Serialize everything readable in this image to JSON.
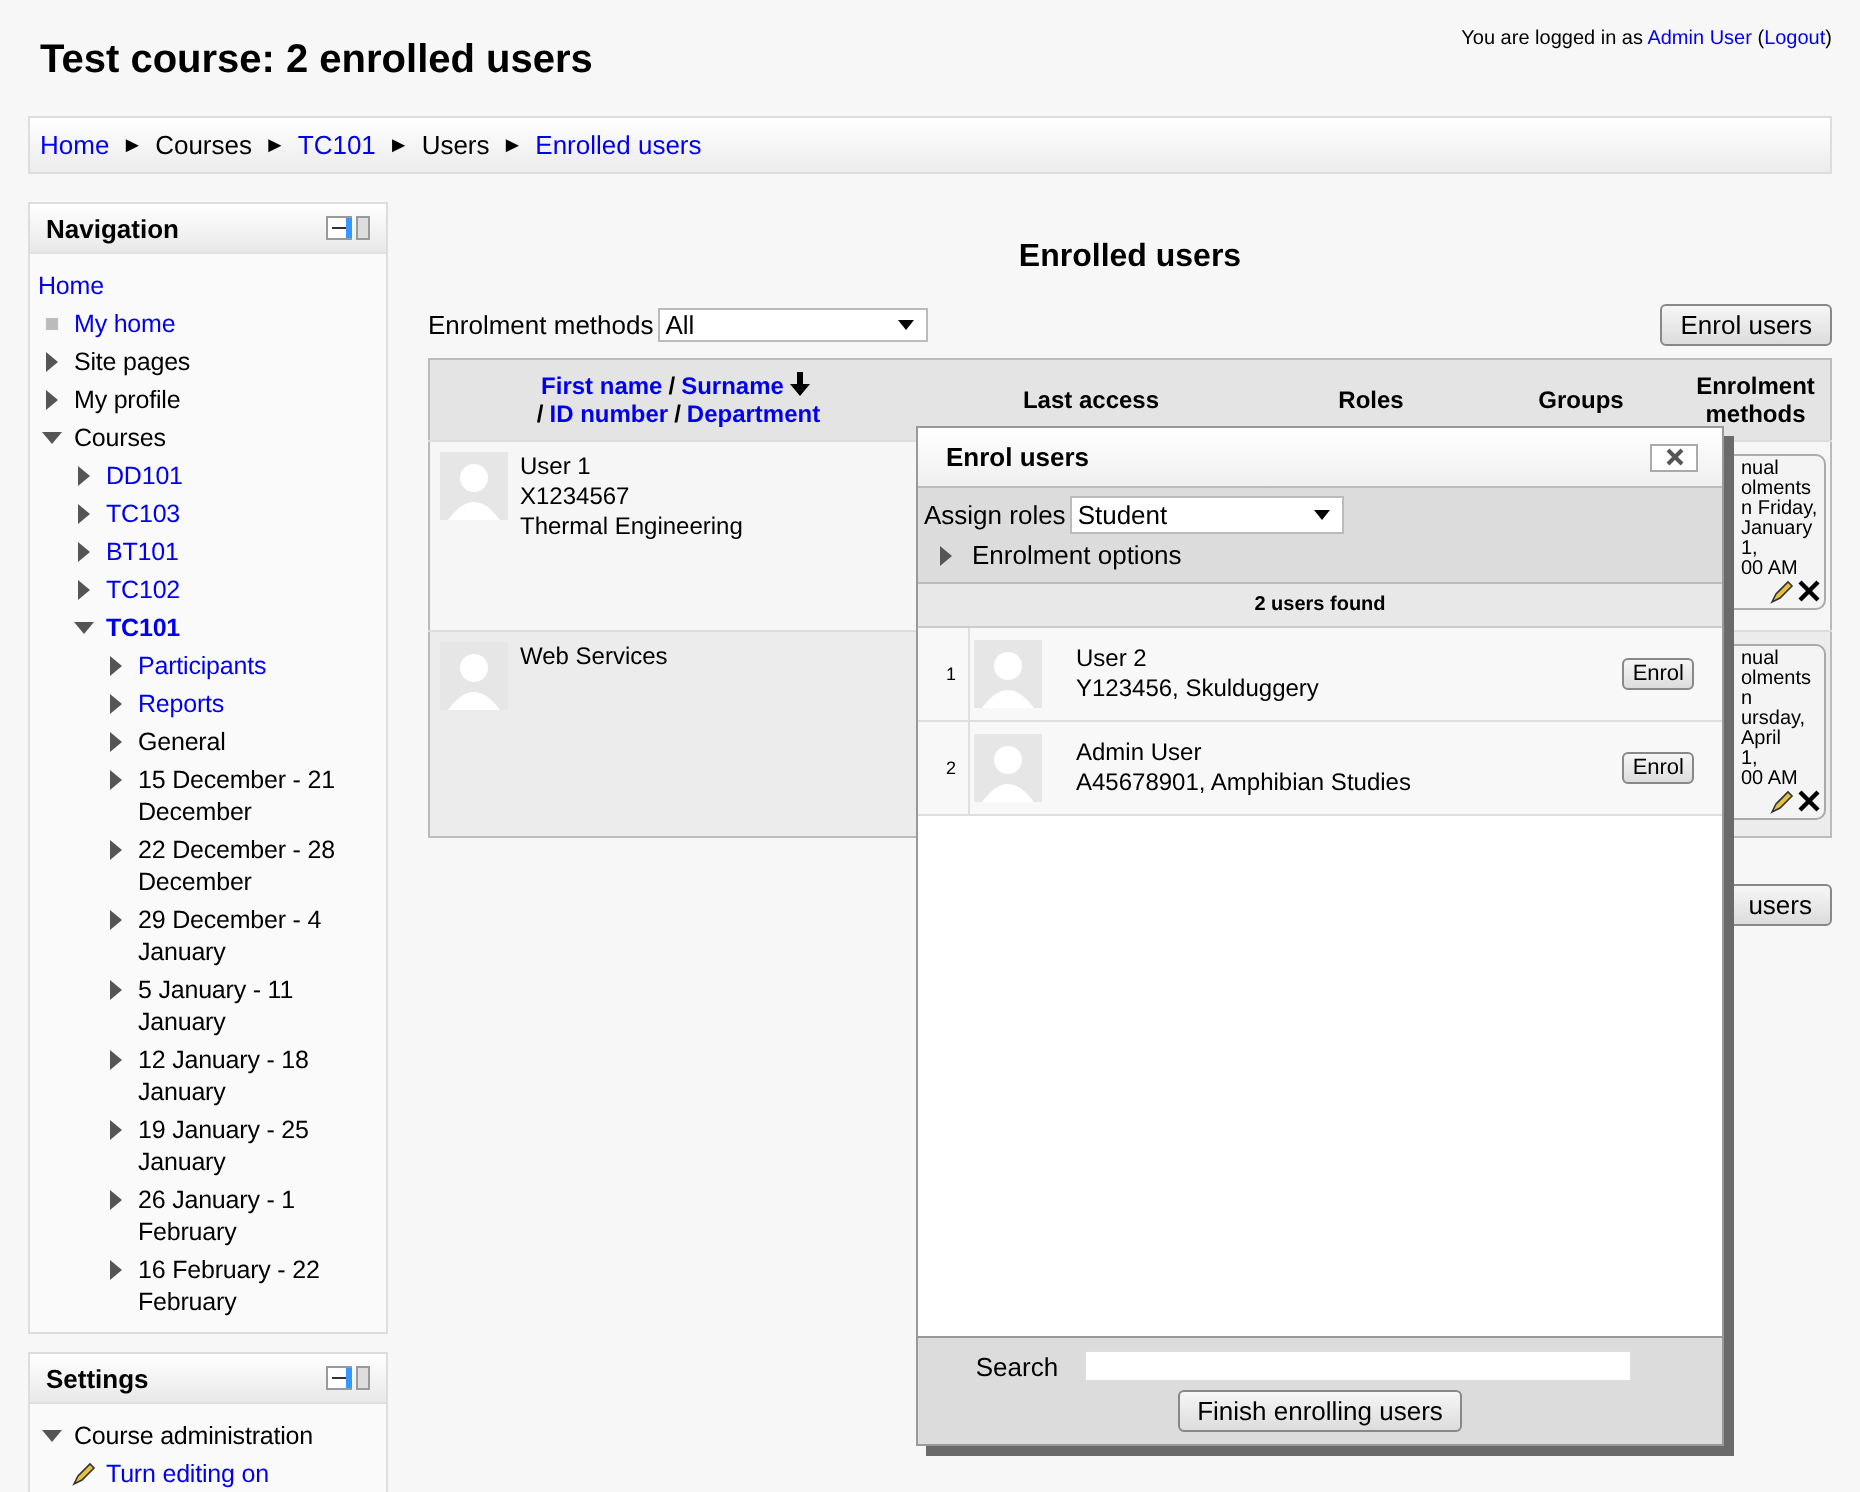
{
  "header": {
    "title": "Test course: 2 enrolled users",
    "login": [
      {
        "text": "You are logged in as ",
        "link": false
      },
      {
        "text": "Admin User",
        "link": true
      },
      {
        "text": " (",
        "link": false
      },
      {
        "text": "Logout",
        "link": true
      },
      {
        "text": ")",
        "link": false
      }
    ]
  },
  "breadcrumb": {
    "separator": "►",
    "items": [
      {
        "label": "Home",
        "link": true
      },
      {
        "label": "Courses",
        "link": false
      },
      {
        "label": "TC101",
        "link": true
      },
      {
        "label": "Users",
        "link": false
      },
      {
        "label": "Enrolled users",
        "link": true
      }
    ]
  },
  "navigation": {
    "title": "Navigation",
    "items": [
      {
        "label": "Home",
        "kind": "plain",
        "link": true
      },
      {
        "label": "My home",
        "kind": "leaf",
        "link": true
      },
      {
        "label": "Site pages",
        "kind": "branch",
        "link": false,
        "expanded": false
      },
      {
        "label": "My profile",
        "kind": "branch",
        "link": false,
        "expanded": false
      },
      {
        "label": "Courses",
        "kind": "branch",
        "link": false,
        "expanded": true,
        "children": [
          {
            "label": "DD101",
            "kind": "branch",
            "link": true,
            "expanded": false,
            "current": false
          },
          {
            "label": "TC103",
            "kind": "branch",
            "link": true,
            "expanded": false,
            "current": false
          },
          {
            "label": "BT101",
            "kind": "branch",
            "link": true,
            "expanded": false,
            "current": false
          },
          {
            "label": "TC102",
            "kind": "branch",
            "link": true,
            "expanded": false,
            "current": false
          },
          {
            "label": "TC101",
            "kind": "branch",
            "link": true,
            "expanded": true,
            "current": true,
            "children": [
              {
                "label": "Participants",
                "kind": "branch",
                "link": true,
                "expanded": false
              },
              {
                "label": "Reports",
                "kind": "branch",
                "link": true,
                "expanded": false
              },
              {
                "label": "General",
                "kind": "branch",
                "link": false,
                "expanded": false
              },
              {
                "label": "15 December - 21 December",
                "kind": "branch",
                "link": false,
                "expanded": false
              },
              {
                "label": "22 December - 28 December",
                "kind": "branch",
                "link": false,
                "expanded": false
              },
              {
                "label": "29 December - 4 January",
                "kind": "branch",
                "link": false,
                "expanded": false
              },
              {
                "label": "5 January - 11 January",
                "kind": "branch",
                "link": false,
                "expanded": false
              },
              {
                "label": "12 January - 18 January",
                "kind": "branch",
                "link": false,
                "expanded": false
              },
              {
                "label": "19 January - 25 January",
                "kind": "branch",
                "link": false,
                "expanded": false
              },
              {
                "label": "26 January - 1 February",
                "kind": "branch",
                "link": false,
                "expanded": false
              },
              {
                "label": "16 February - 22 February",
                "kind": "branch",
                "link": false,
                "expanded": false
              }
            ]
          }
        ]
      }
    ]
  },
  "settings": {
    "title": "Settings",
    "items": [
      {
        "label": "Course administration",
        "kind": "branch",
        "link": false,
        "expanded": true,
        "children": [
          {
            "label": "Turn editing on",
            "kind": "edit",
            "link": true
          }
        ]
      }
    ]
  },
  "main": {
    "heading": "Enrolled users",
    "filter": {
      "label": "Enrolment methods",
      "value": "All"
    },
    "enrol_button": "Enrol users",
    "table": {
      "separator": "/",
      "name_header": [
        {
          "label": "First name",
          "sort": false
        },
        {
          "label": "Surname",
          "sort": true
        },
        {
          "label": "ID number",
          "sort": false
        },
        {
          "label": "Department",
          "sort": false
        }
      ],
      "columns": [
        "Last access",
        "Roles",
        "Groups",
        "Enrolment methods"
      ],
      "rows": [
        {
          "lines": [
            "User 1",
            "X1234567",
            "Thermal Engineering"
          ],
          "methods": [
            "nual",
            "olments",
            "n Friday,",
            "January",
            "1,",
            "00 AM"
          ]
        },
        {
          "lines": [
            "Web Services"
          ],
          "methods": [
            "nual",
            "olments",
            "n",
            "ursday,",
            "April",
            "1,",
            "00 AM"
          ]
        }
      ]
    },
    "bottom_button": "users"
  },
  "dialog": {
    "title": "Enrol users",
    "assign_label": "Assign roles",
    "role": "Student",
    "options": {
      "label": "Enrolment options",
      "expanded": false
    },
    "found": "2 users found",
    "users": [
      {
        "index": "1",
        "name": "User 2",
        "detail": "Y123456, Skulduggery",
        "button": "Enrol"
      },
      {
        "index": "2",
        "name": "Admin User",
        "detail": "A45678901, Amphibian Studies",
        "button": "Enrol"
      }
    ],
    "search_label": "Search",
    "finish": "Finish enrolling users"
  }
}
